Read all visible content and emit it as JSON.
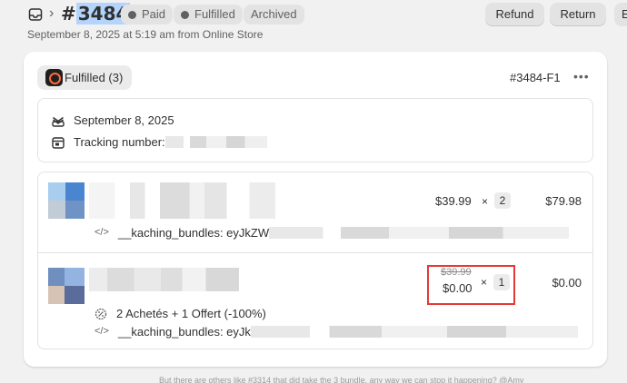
{
  "header": {
    "order_number": "#3484",
    "badges": [
      {
        "label": "Paid"
      },
      {
        "label": "Fulfilled"
      },
      {
        "label": "Archived"
      }
    ],
    "subtitle": "September 8, 2025 at 5:19 am from Online Store",
    "buttons": {
      "refund": "Refund",
      "return": "Return",
      "more": "E"
    }
  },
  "fulfillment": {
    "status": "Fulfilled (3)",
    "id": "#3484-F1",
    "more": "•••",
    "date": "September 8, 2025",
    "tracking_label": "Tracking number:"
  },
  "items": [
    {
      "unit_price": "$39.99",
      "times": "×",
      "quantity": "2",
      "total": "$79.98",
      "property": "__kaching_bundles: eyJkZW"
    },
    {
      "original_price": "$39.99",
      "unit_price": "$0.00",
      "times": "×",
      "quantity": "1",
      "total": "$0.00",
      "discount": "2 Achetés + 1 Offert (-100%)",
      "property": "__kaching_bundles: eyJk"
    }
  ],
  "footer_text": "But there are others like #3314 that did take the 3 bundle, any way we can stop it happening? @Amy",
  "colors": {
    "page_bg": "#f1f1f1",
    "highlight": "#b3d4fc",
    "annotation_red": "#e53935"
  },
  "icons": [
    "inbox-icon",
    "chevron-right-icon",
    "fulfilled-app-icon",
    "delivery-icon",
    "tracking-icon",
    "code-icon",
    "discount-icon"
  ]
}
